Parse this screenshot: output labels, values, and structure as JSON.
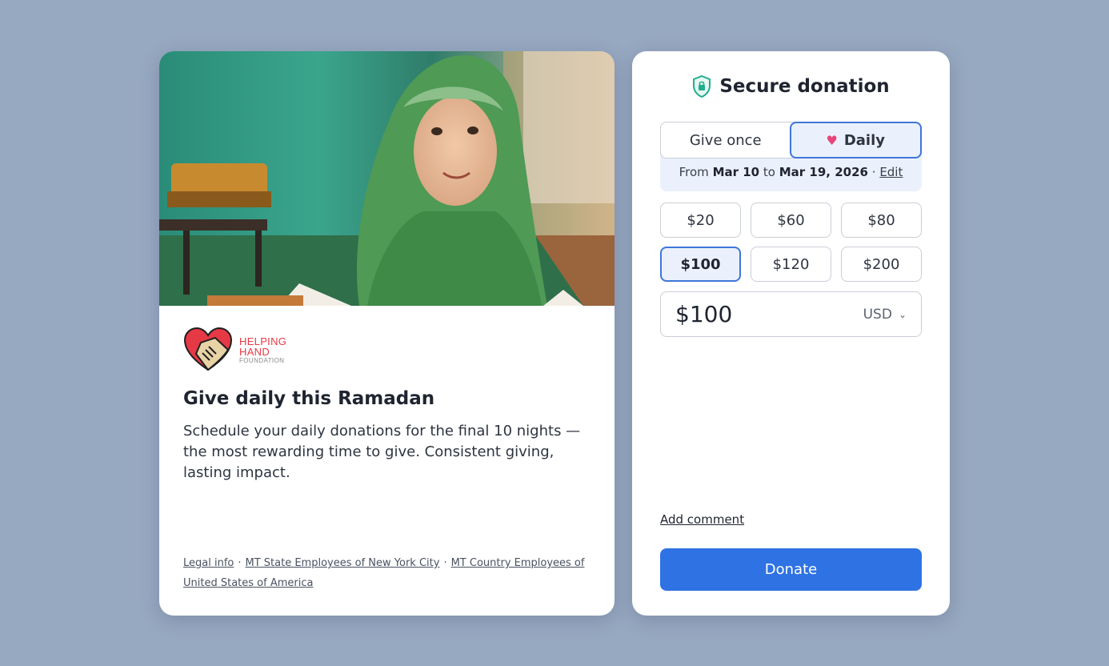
{
  "campaign": {
    "logo": {
      "line1": "HELPING",
      "line2": "HAND",
      "line3": "FOUNDATION"
    },
    "headline": "Give daily this Ramadan",
    "description": "Schedule your daily donations for the final 10 nights — the most rewarding time to give. Consistent giving, lasting impact.",
    "footer_links": [
      "Legal info",
      "MT State Employees of New York City",
      "MT Country Employees of United States of America"
    ],
    "footer_separator": "·"
  },
  "donation": {
    "title": "Secure donation",
    "frequency": {
      "options": [
        "Give once",
        "Daily"
      ],
      "selected": "Daily"
    },
    "schedule": {
      "from_label": "From",
      "start": "Mar 10",
      "to_label": "to",
      "end": "Mar 19, 2026",
      "separator": "·",
      "edit_label": "Edit"
    },
    "amount_options": [
      "$20",
      "$60",
      "$80",
      "$100",
      "$120",
      "$200"
    ],
    "selected_amount": "$100",
    "amount_value": "$100",
    "currency": "USD",
    "add_comment_label": "Add comment",
    "donate_label": "Donate"
  },
  "colors": {
    "background": "#97a8c1",
    "accent": "#2f72e4",
    "selected_border": "#3f76d9",
    "selected_fill": "#eaf1fd",
    "heart": "#e8457a",
    "shield": "#1fae8e",
    "logo_red": "#e63946"
  },
  "icons": {
    "secure": "shield-lock-icon",
    "daily": "heart-icon",
    "currency": "chevron-down-icon",
    "logo": "heart-handshake-icon"
  }
}
